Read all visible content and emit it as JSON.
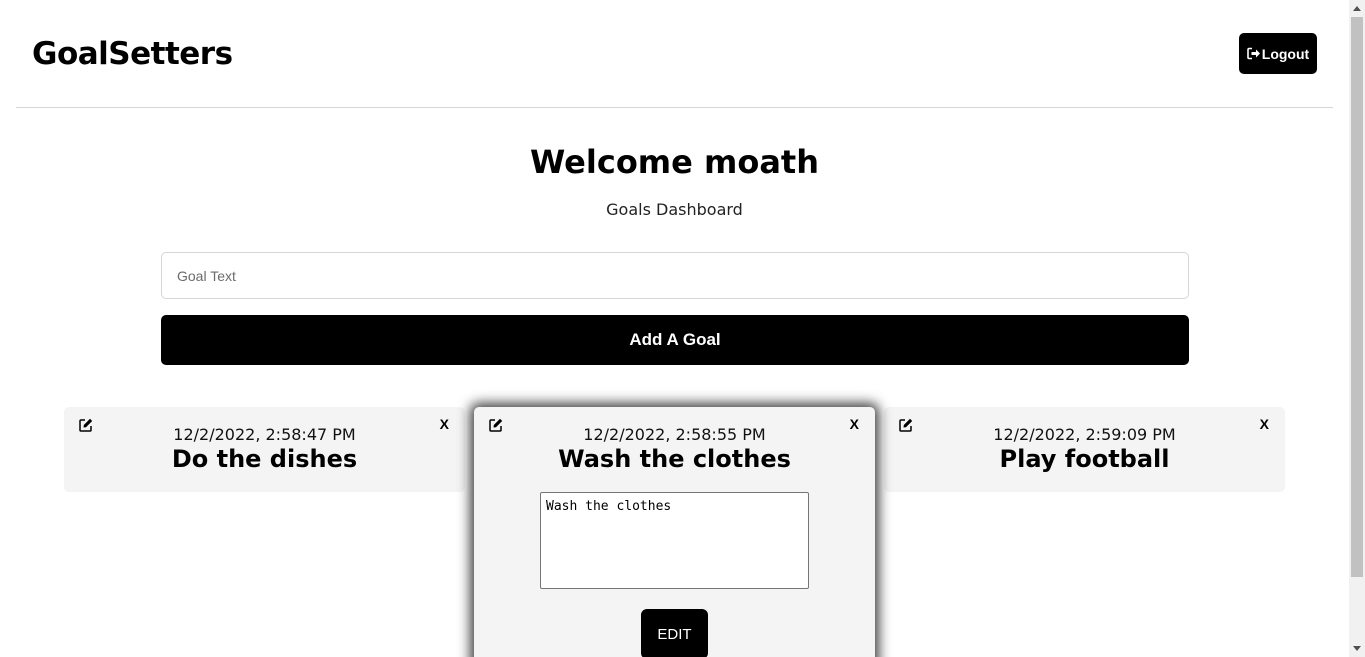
{
  "header": {
    "logo": "GoalSetters",
    "logout_label": "Logout"
  },
  "dashboard": {
    "welcome": "Welcome moath",
    "subtitle": "Goals Dashboard"
  },
  "form": {
    "placeholder": "Goal Text",
    "value": "",
    "add_label": "Add A Goal"
  },
  "goals": [
    {
      "date": "12/2/2022, 2:58:47 PM",
      "text": "Do the dishes",
      "close": "X"
    },
    {
      "date": "12/2/2022, 2:58:55 PM",
      "text": "Wash the clothes",
      "close": "X",
      "edit_value": "Wash the clothes",
      "edit_label": "EDIT"
    },
    {
      "date": "12/2/2022, 2:59:09 PM",
      "text": "Play football",
      "close": "X"
    }
  ],
  "colors": {
    "primary": "#000000",
    "card_bg": "#f4f4f4",
    "divider": "#d6d6d6"
  },
  "icons": {
    "logout": "sign-out-icon",
    "edit": "edit-icon"
  }
}
